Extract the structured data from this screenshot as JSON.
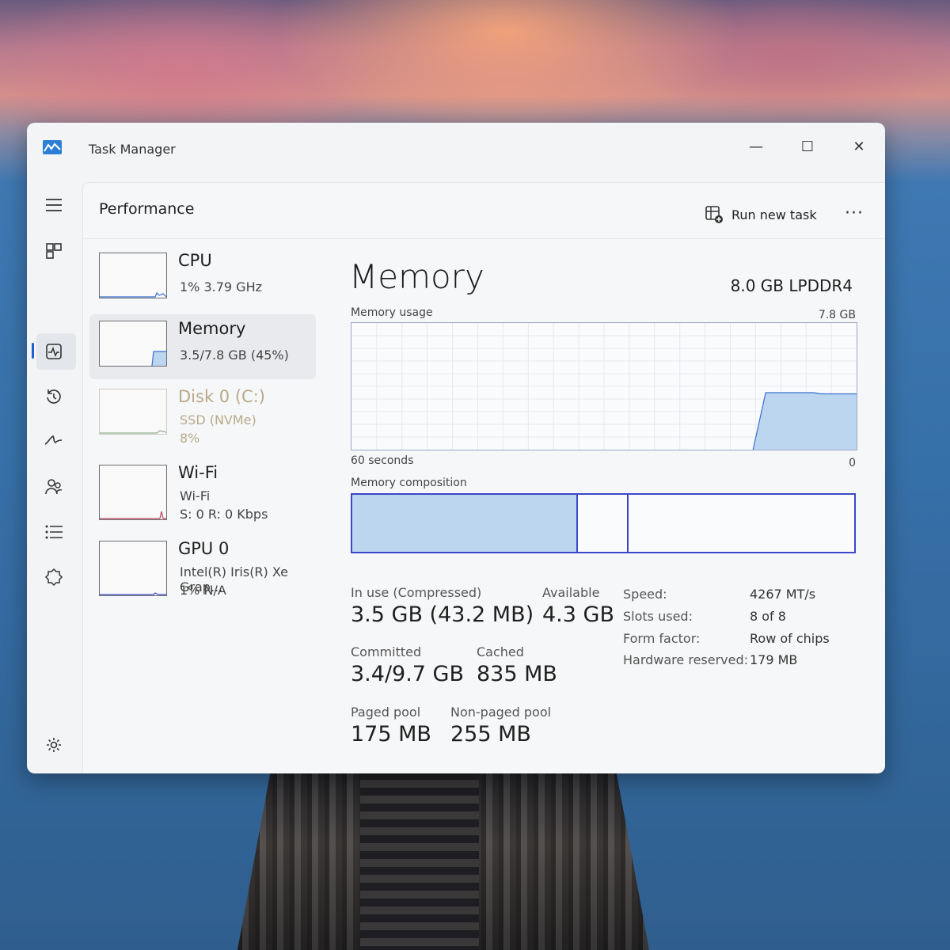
{
  "window": {
    "title": "Task Manager",
    "minimize_glyph": "—",
    "maximize_glyph": "☐",
    "close_glyph": "✕"
  },
  "sidebar": {
    "items": [
      {
        "name": "hamburger-menu-icon"
      },
      {
        "name": "processes-icon"
      },
      {
        "name": "performance-icon",
        "active": true
      },
      {
        "name": "app-history-icon"
      },
      {
        "name": "startup-apps-icon"
      },
      {
        "name": "users-icon"
      },
      {
        "name": "details-icon"
      },
      {
        "name": "services-icon"
      }
    ],
    "settings": {
      "name": "settings-icon"
    }
  },
  "header": {
    "title": "Performance",
    "run_task_label": "Run new task",
    "more_label": "···"
  },
  "resources": [
    {
      "title": "CPU",
      "line1": "1%  3.79 GHz",
      "line2": ""
    },
    {
      "title": "Memory",
      "line1": "3.5/7.8 GB (45%)",
      "line2": "",
      "selected": true
    },
    {
      "title": "Disk 0 (C:)",
      "line1": "SSD (NVMe)",
      "line2": "8%"
    },
    {
      "title": "Wi-Fi",
      "line1": "Wi-Fi",
      "line2": "S: 0  R: 0 Kbps"
    },
    {
      "title": "GPU 0",
      "line1": "Intel(R) Iris(R) Xe Grap...",
      "line2": "1%  N/A"
    }
  ],
  "detail": {
    "title": "Memory",
    "spec": "8.0 GB LPDDR4",
    "usage_label": "Memory usage",
    "usage_max": "7.8 GB",
    "time_label": "60 seconds",
    "min_label": "0",
    "composition_label": "Memory composition",
    "usage_fraction": 0.45,
    "composition": {
      "in_use_fraction": 0.45,
      "modified_fraction": 0.1
    },
    "stats": {
      "in_use_label": "In use (Compressed)",
      "in_use_value": "3.5 GB (43.2 MB)",
      "available_label": "Available",
      "available_value": "4.3 GB",
      "committed_label": "Committed",
      "committed_value": "3.4/9.7 GB",
      "cached_label": "Cached",
      "cached_value": "835 MB",
      "paged_label": "Paged pool",
      "paged_value": "175 MB",
      "nonpaged_label": "Non-paged pool",
      "nonpaged_value": "255 MB"
    },
    "specs": {
      "speed_label": "Speed:",
      "speed_value": "4267 MT/s",
      "slots_label": "Slots used:",
      "slots_value": "8 of 8",
      "form_label": "Form factor:",
      "form_value": "Row of chips",
      "reserved_label": "Hardware reserved:",
      "reserved_value": "179 MB"
    }
  },
  "colors": {
    "accent": "#1f5fd6",
    "graph_fill": "#bcd6f0",
    "graph_line": "#3a6fd0",
    "composition_border": "#3a48c8"
  }
}
